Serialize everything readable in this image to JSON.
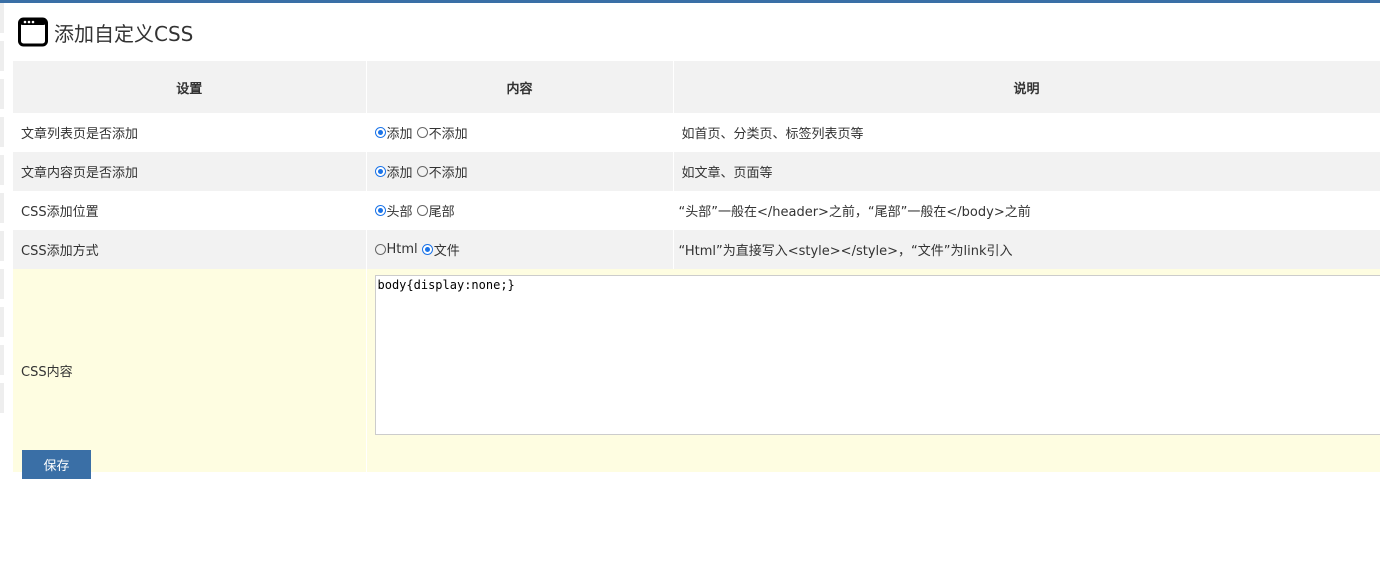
{
  "page": {
    "title": "添加自定义CSS",
    "accent": "#3a6fa6"
  },
  "table": {
    "headers": [
      "设置",
      "内容",
      "说明"
    ],
    "rows": [
      {
        "setting": "文章列表页是否添加",
        "options": [
          "添加",
          "不添加"
        ],
        "selected": 0,
        "description": "如首页、分类页、标签列表页等"
      },
      {
        "setting": "文章内容页是否添加",
        "options": [
          "添加",
          "不添加"
        ],
        "selected": 0,
        "description": "如文章、页面等"
      },
      {
        "setting": "CSS添加位置",
        "options": [
          "头部",
          "尾部"
        ],
        "selected": 0,
        "description": "“头部”一般在</header>之前，“尾部”一般在</body>之前"
      },
      {
        "setting": "CSS添加方式",
        "options": [
          "Html",
          "文件"
        ],
        "selected": 1,
        "description": "“Html”为直接写入<style></style>，“文件”为link引入"
      }
    ],
    "css_row": {
      "label": "CSS内容",
      "value": "body{display:none;}"
    }
  },
  "save_label": "保存"
}
